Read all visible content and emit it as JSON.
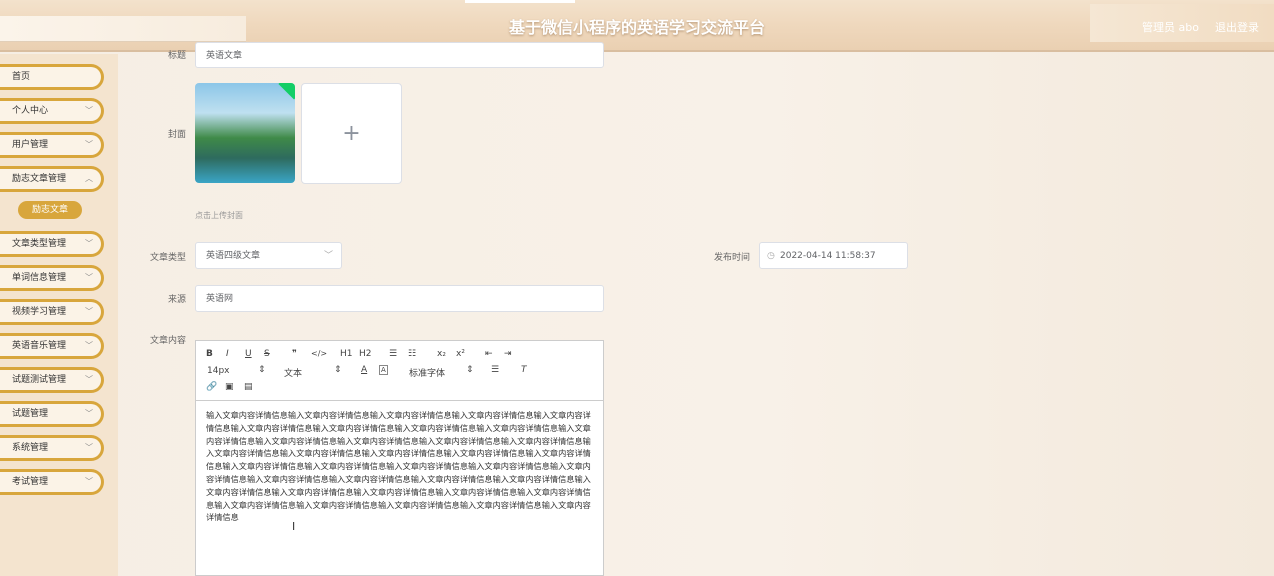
{
  "header": {
    "title": "基于微信小程序的英语学习交流平台",
    "user": "管理员 abo",
    "logout": "退出登录"
  },
  "sidebar": {
    "items": [
      {
        "label": "首页",
        "has_arrow": false
      },
      {
        "label": "个人中心",
        "has_arrow": true
      },
      {
        "label": "用户管理",
        "has_arrow": true
      },
      {
        "label": "励志文章管理",
        "has_arrow": true
      },
      {
        "label": "文章类型管理",
        "has_arrow": true
      },
      {
        "label": "单词信息管理",
        "has_arrow": true
      },
      {
        "label": "视频学习管理",
        "has_arrow": true
      },
      {
        "label": "英语音乐管理",
        "has_arrow": true
      },
      {
        "label": "试题测试管理",
        "has_arrow": true
      },
      {
        "label": "试题管理",
        "has_arrow": true
      },
      {
        "label": "系统管理",
        "has_arrow": true
      },
      {
        "label": "考试管理",
        "has_arrow": true
      }
    ],
    "submenu": "励志文章"
  },
  "form": {
    "title_label": "标题",
    "title_value": "英语文章",
    "cover_label": "封面",
    "upload_plus": "+",
    "cover_hint": "点击上传封面",
    "type_label": "文章类型",
    "type_value": "英语四级文章",
    "publish_label": "发布时间",
    "publish_value": "2022-04-14 11:58:37",
    "source_label": "来源",
    "source_value": "英语网",
    "content_label": "文章内容"
  },
  "editor": {
    "toolbar_row1": [
      "B",
      "I",
      "U",
      "S",
      "❞",
      "</>",
      "H1",
      "H2",
      "☰",
      "☷",
      "x₂",
      "x²",
      "⇤",
      "⇥"
    ],
    "font_size": "14px",
    "text_style": "文本",
    "font_family": "标准字体",
    "content": "输入文章内容详情信息输入文章内容详情信息输入文章内容详情信息输入文章内容详情信息输入文章内容详情信息输入文章内容详情信息输入文章内容详情信息输入文章内容详情信息输入文章内容详情信息输入文章内容详情信息输入文章内容详情信息输入文章内容详情信息输入文章内容详情信息输入文章内容详情信息输入文章内容详情信息输入文章内容详情信息输入文章内容详情信息输入文章内容详情信息输入文章内容详情信息输入文章内容详情信息输入文章内容详情信息输入文章内容详情信息输入文章内容详情信息输入文章内容详情信息输入文章内容详情信息输入文章内容详情信息输入文章内容详情信息输入文章内容详情信息输入文章内容详情信息输入文章内容详情信息输入文章内容详情信息输入文章内容详情信息输入文章内容详情信息输入文章内容详情信息输入文章内容详情信息输入文章内容详情信息输入文章内容详情信息输入文章内容详情信息"
  }
}
